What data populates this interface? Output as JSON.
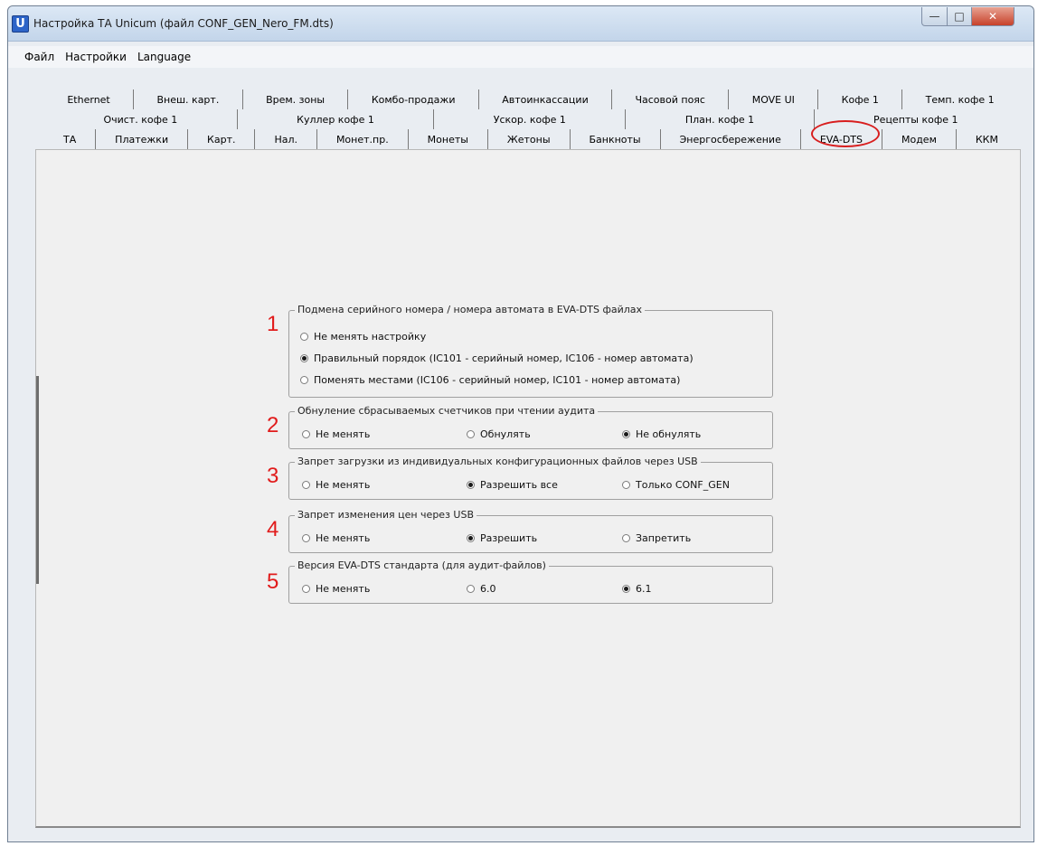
{
  "window": {
    "title": "Настройка ТА Unicum (файл CONF_GEN_Nero_FM.dts)",
    "icon": "unicum-app-icon"
  },
  "menu": [
    "Файл",
    "Настройки",
    "Language"
  ],
  "tabs": {
    "row1": [
      "Ethernet",
      "Внеш. карт.",
      "Врем. зоны",
      "Комбо-продажи",
      "Автоинкассации",
      "Часовой пояс",
      "MOVE UI",
      "Кофе 1",
      "Темп. кофе 1"
    ],
    "row2": [
      "Очист. кофе 1",
      "Куллер кофе 1",
      "Ускор. кофе 1",
      "План. кофе 1",
      "Рецепты кофе 1"
    ],
    "row3": [
      "ТА",
      "Платежки",
      "Карт.",
      "Нал.",
      "Монет.пр.",
      "Монеты",
      "Жетоны",
      "Банкноты",
      "Энергосбережение",
      "EVA-DTS",
      "Модем",
      "ККМ"
    ],
    "selected": "EVA-DTS"
  },
  "groups": [
    {
      "number": "1",
      "title": "Подмена серийного номера / номера автомата в EVA-DTS файлах",
      "options": [
        {
          "label": "Не менять настройку",
          "checked": false
        },
        {
          "label": "Правильный порядок (IC101 - серийный номер, IC106 - номер автомата)",
          "checked": true
        },
        {
          "label": "Поменять местами (IC106 - серийный номер, IC101 - номер автомата)",
          "checked": false
        }
      ]
    },
    {
      "number": "2",
      "title": "Обнуление сбрасываемых счетчиков при чтении аудита",
      "options": [
        {
          "label": "Не менять",
          "checked": false
        },
        {
          "label": "Обнулять",
          "checked": false
        },
        {
          "label": "Не обнулять",
          "checked": true
        }
      ]
    },
    {
      "number": "3",
      "title": "Запрет загрузки из индивидуальных конфигурационных файлов через USB",
      "options": [
        {
          "label": "Не менять",
          "checked": false
        },
        {
          "label": "Разрешить все",
          "checked": true
        },
        {
          "label": "Только CONF_GEN",
          "checked": false
        }
      ]
    },
    {
      "number": "4",
      "title": "Запрет изменения цен через USB",
      "options": [
        {
          "label": "Не менять",
          "checked": false
        },
        {
          "label": "Разрешить",
          "checked": true
        },
        {
          "label": "Запретить",
          "checked": false
        }
      ]
    },
    {
      "number": "5",
      "title": "Версия EVA-DTS стандарта (для аудит-файлов)",
      "options": [
        {
          "label": "Не менять",
          "checked": false
        },
        {
          "label": "6.0",
          "checked": false
        },
        {
          "label": "6.1",
          "checked": true
        }
      ]
    }
  ],
  "colors": {
    "annotation": "#e11b1b",
    "window_bg": "#f0f0f0"
  }
}
